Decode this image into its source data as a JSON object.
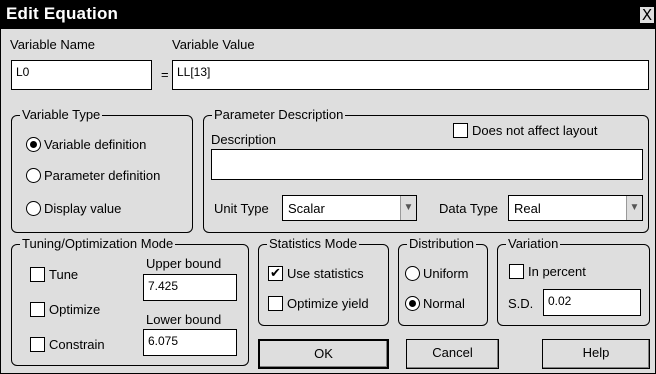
{
  "window": {
    "title": "Edit Equation",
    "close_glyph": "X"
  },
  "variable": {
    "name_label": "Variable Name",
    "name_value": "L0",
    "equals": "=",
    "value_label": "Variable Value",
    "value_value": "LL[13]"
  },
  "variable_type": {
    "title": "Variable Type",
    "options": [
      "Variable definition",
      "Parameter definition",
      "Display value"
    ],
    "selected": "Variable definition"
  },
  "param_desc": {
    "title": "Parameter Description",
    "description_label": "Description",
    "description_value": "",
    "does_not_affect_label": "Does not affect layout",
    "does_not_affect_checked": false,
    "unit_type_label": "Unit Type",
    "unit_type_value": "Scalar",
    "data_type_label": "Data Type",
    "data_type_value": "Real"
  },
  "tuning": {
    "title": "Tuning/Optimization Mode",
    "tune_label": "Tune",
    "optimize_label": "Optimize",
    "constrain_label": "Constrain",
    "upper_label": "Upper bound",
    "upper_value": "7.425",
    "lower_label": "Lower bound",
    "lower_value": "6.075"
  },
  "statistics": {
    "title": "Statistics Mode",
    "use_stats_label": "Use statistics",
    "use_stats_checked": true,
    "optimize_yield_label": "Optimize yield",
    "checkmark": "✔"
  },
  "distribution": {
    "title": "Distribution",
    "options": [
      "Uniform",
      "Normal"
    ],
    "selected": "Normal"
  },
  "variation": {
    "title": "Variation",
    "percent_label": "In percent",
    "sd_label": "S.D.",
    "sd_value": "0.02"
  },
  "buttons": {
    "ok": "OK",
    "cancel": "Cancel",
    "help": "Help"
  },
  "icons": {
    "dropdown": "chevron-down-icon",
    "close": "close-icon"
  }
}
